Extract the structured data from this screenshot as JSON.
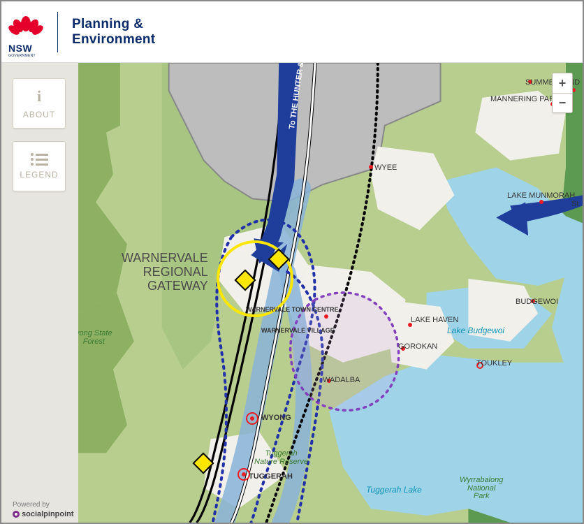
{
  "header": {
    "org_short": "NSW",
    "org_sub": "GOVERNMENT",
    "dept_line1": "Planning &",
    "dept_line2": "Environment"
  },
  "controls": {
    "about_label": "ABOUT",
    "legend_label": "LEGEND",
    "zoom_in": "+",
    "zoom_out": "−"
  },
  "footer": {
    "powered_by": "Powered by",
    "brand": "socialpinpoint"
  },
  "arrow_label": "To THE HUNTER & NORTH",
  "labels": {
    "warnervale_gateway_l1": "WARNERVALE",
    "warnervale_gateway_l2": "REGIONAL",
    "warnervale_gateway_l3": "GATEWAY",
    "warnervale_tc": "WARNERVALE TOWN CENTRE",
    "warnervale_village": "WARNERVALE VILLAGE",
    "wyong_forest_l1": "yong State",
    "wyong_forest_l2": "Forest",
    "summerland": "SUMMERLAND P",
    "mannering": "MANNERING PARK",
    "wyee": "WYEE",
    "munmorah": "LAKE MUNMORAH",
    "budgewoi": "BUDGEWOI",
    "lake_budgewoi": "Lake Budgewoi",
    "lake_haven": "LAKE HAVEN",
    "gorokan": "GOROKAN",
    "toukley": "TOUKLEY",
    "wadalba": "WADALBA",
    "wyong": "WYONG",
    "tuggerah": "TUGGERAH",
    "tuggerah_reserve_l1": "Tuggerah",
    "tuggerah_reserve_l2": "Nature Reserve",
    "tuggerah_lake": "Tuggerah Lake",
    "wyrrabalong_l1": "Wyrrabalong",
    "wyrrabalong_l2": "National",
    "wyrrabalong_l3": "Park",
    "st": "St"
  },
  "colors": {
    "water": "#9fd4e8",
    "green_light": "#b8ce8e",
    "green_mid": "#8db063",
    "green_dark": "#4f8f45",
    "grey_zone": "#b0b0b0",
    "urban": "#f2f0ea",
    "arrow": "#1f3e9b",
    "corridor_blue": "#88b3d8",
    "dash_purple": "#8340bd",
    "dash_blue": "#2030a8",
    "road_black": "#000000"
  }
}
